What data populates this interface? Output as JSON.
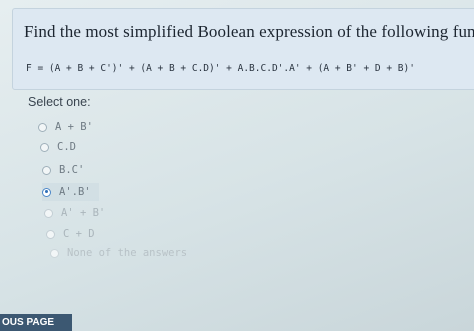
{
  "question": {
    "title": "Find the most simplified Boolean expression of the following function:",
    "expression": "F = (A + B + C')' + (A + B + C.D)' + A.B.C.D'.A' + (A + B' + D + B)'"
  },
  "answer": {
    "prompt": "Select one:",
    "options": [
      {
        "label": "A + B'",
        "selected": false
      },
      {
        "label": "C.D",
        "selected": false
      },
      {
        "label": "B.C'",
        "selected": false
      },
      {
        "label": "A'.B'",
        "selected": true
      },
      {
        "label": "A' + B'",
        "selected": false
      },
      {
        "label": "C + D",
        "selected": false
      },
      {
        "label": "None of the answers",
        "selected": false
      }
    ]
  },
  "navigation": {
    "previous_label": "OUS PAGE"
  },
  "colors": {
    "accent": "#2f6fb8",
    "card": "#dde8f2",
    "button": "#3c5872"
  }
}
